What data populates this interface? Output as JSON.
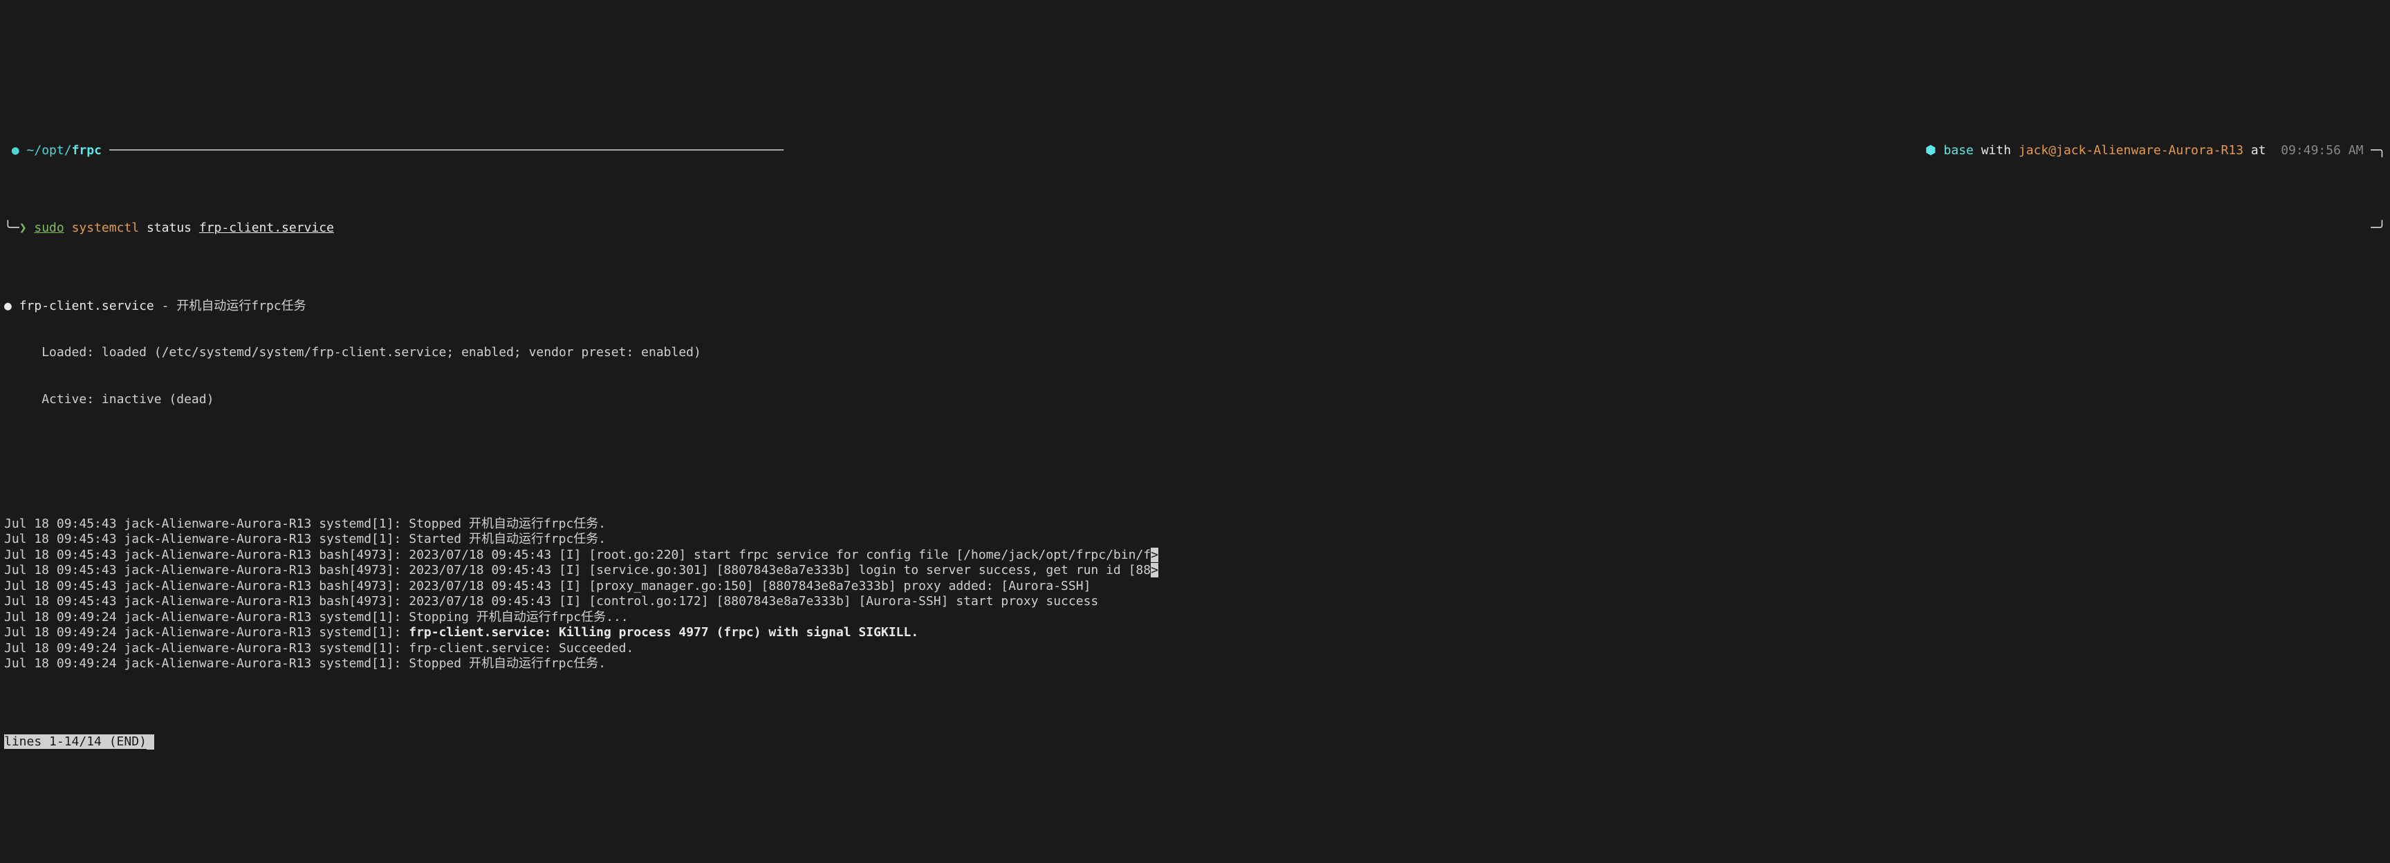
{
  "header": {
    "left_glyph": "",
    "bullet": "●",
    "tilde": "~/opt/",
    "cwd": "frpc",
    "rule": "──────────────────────────────────────────────────────────────────────────────────────────",
    "polygon": "⬢",
    "env": "base",
    "with": "with",
    "user": "jack@jack-Alienware-Aurora-R13",
    "at": "at",
    "clock_glyph": "",
    "time": "09:49:56 AM",
    "right_corner": "─╮",
    "left_corner_bot": "╰─",
    "prompt_char": "❯",
    "right_corner_bot": "─╯"
  },
  "command": {
    "sudo": "sudo",
    "systemctl": "systemctl",
    "status": "status",
    "unit": "frp-client.service"
  },
  "status": {
    "bullet": "●",
    "unit": "frp-client.service",
    "dash": "-",
    "description": "开机自动运行frpc任务",
    "loaded_label": "Loaded:",
    "loaded_value": "loaded (/etc/systemd/system/frp-client.service; enabled; vendor preset: enabled)",
    "active_label": "Active:",
    "active_value": "inactive (dead)"
  },
  "logs": [
    {
      "ts": "Jul 18 09:45:43",
      "host": "jack-Alienware-Aurora-R13",
      "proc": "systemd[1]:",
      "msg": "Stopped 开机自动运行frpc任务.",
      "bold": false,
      "trunc": ""
    },
    {
      "ts": "Jul 18 09:45:43",
      "host": "jack-Alienware-Aurora-R13",
      "proc": "systemd[1]:",
      "msg": "Started 开机自动运行frpc任务.",
      "bold": false,
      "trunc": ""
    },
    {
      "ts": "Jul 18 09:45:43",
      "host": "jack-Alienware-Aurora-R13",
      "proc": "bash[4973]:",
      "msg": "2023/07/18 09:45:43 [I] [root.go:220] start frpc service for config file [/home/jack/opt/frpc/bin/f",
      "bold": false,
      "trunc": ">"
    },
    {
      "ts": "Jul 18 09:45:43",
      "host": "jack-Alienware-Aurora-R13",
      "proc": "bash[4973]:",
      "msg": "2023/07/18 09:45:43 [I] [service.go:301] [8807843e8a7e333b] login to server success, get run id [88",
      "bold": false,
      "trunc": ">"
    },
    {
      "ts": "Jul 18 09:45:43",
      "host": "jack-Alienware-Aurora-R13",
      "proc": "bash[4973]:",
      "msg": "2023/07/18 09:45:43 [I] [proxy_manager.go:150] [8807843e8a7e333b] proxy added: [Aurora-SSH]",
      "bold": false,
      "trunc": ""
    },
    {
      "ts": "Jul 18 09:45:43",
      "host": "jack-Alienware-Aurora-R13",
      "proc": "bash[4973]:",
      "msg": "2023/07/18 09:45:43 [I] [control.go:172] [8807843e8a7e333b] [Aurora-SSH] start proxy success",
      "bold": false,
      "trunc": ""
    },
    {
      "ts": "Jul 18 09:49:24",
      "host": "jack-Alienware-Aurora-R13",
      "proc": "systemd[1]:",
      "msg": "Stopping 开机自动运行frpc任务...",
      "bold": false,
      "trunc": ""
    },
    {
      "ts": "Jul 18 09:49:24",
      "host": "jack-Alienware-Aurora-R13",
      "proc": "systemd[1]:",
      "msg": "frp-client.service: Killing process 4977 (frpc) with signal SIGKILL.",
      "bold": true,
      "trunc": ""
    },
    {
      "ts": "Jul 18 09:49:24",
      "host": "jack-Alienware-Aurora-R13",
      "proc": "systemd[1]:",
      "msg": "frp-client.service: Succeeded.",
      "bold": false,
      "trunc": ""
    },
    {
      "ts": "Jul 18 09:49:24",
      "host": "jack-Alienware-Aurora-R13",
      "proc": "systemd[1]:",
      "msg": "Stopped 开机自动运行frpc任务.",
      "bold": false,
      "trunc": ""
    }
  ],
  "pager": {
    "status": "lines 1-14/14 (END)"
  }
}
